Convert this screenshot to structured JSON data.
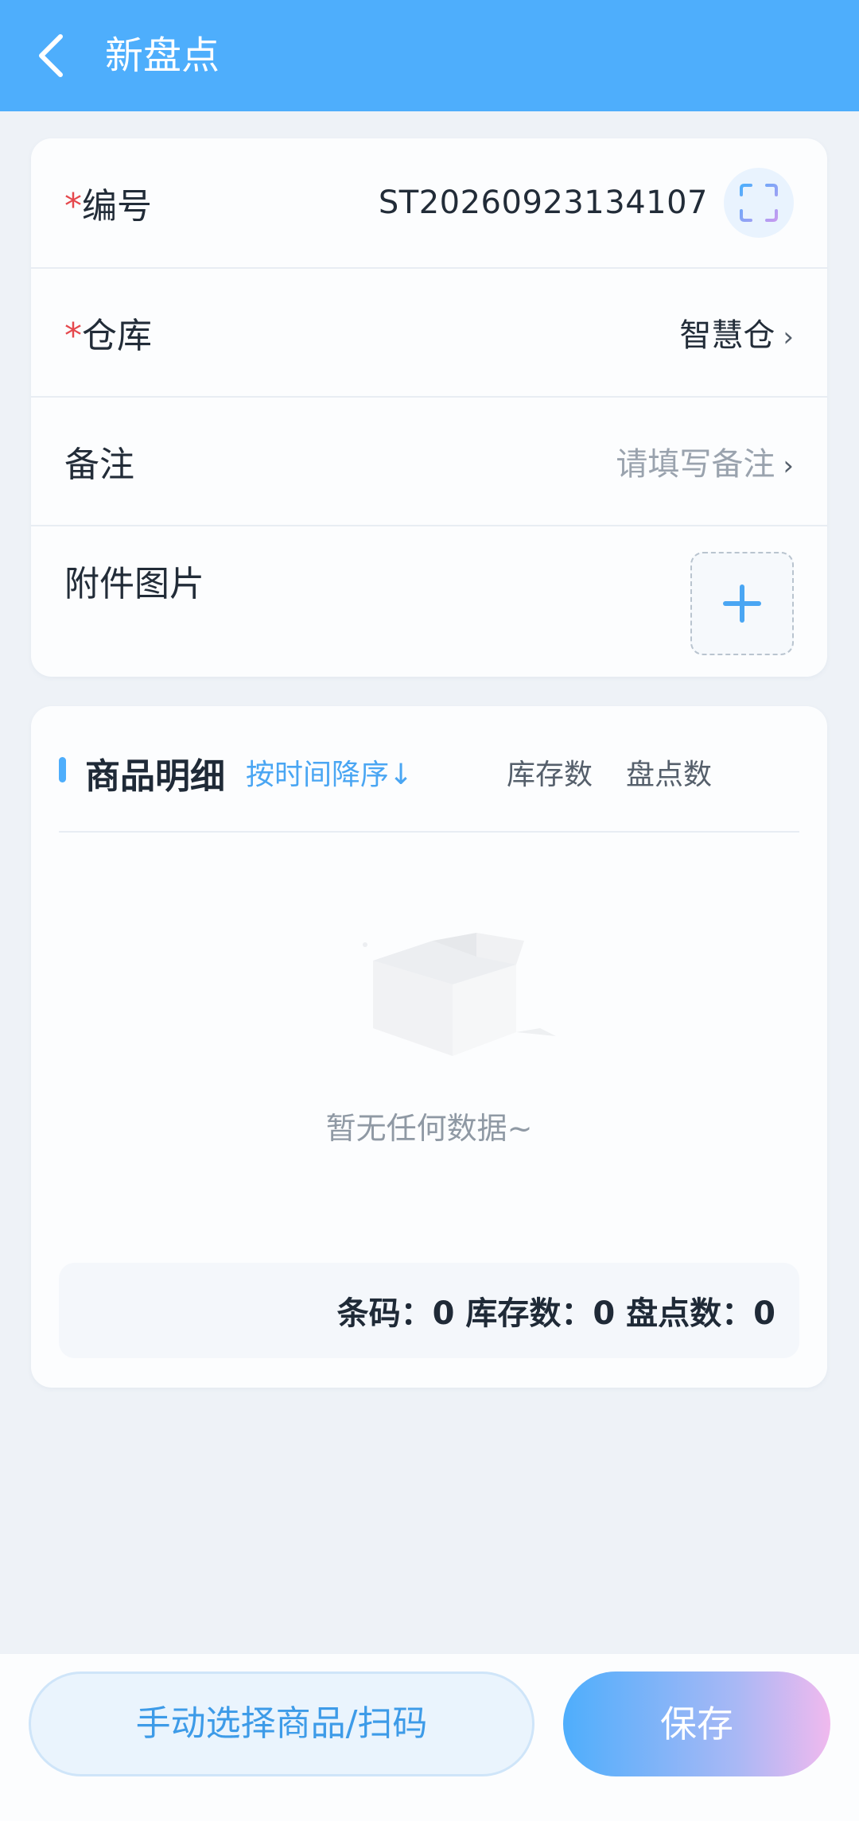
{
  "header": {
    "title": "新盘点",
    "back_icon": "chevron-left-icon"
  },
  "form": {
    "code": {
      "required_mark": "*",
      "label": "编号",
      "value": "ST20260923134107",
      "scan_icon": "scan-icon"
    },
    "warehouse": {
      "required_mark": "*",
      "label": "仓库",
      "value": "智慧仓",
      "chevron": "›"
    },
    "remark": {
      "label": "备注",
      "placeholder": "请填写备注",
      "chevron": "›"
    },
    "attachment": {
      "label": "附件图片",
      "add_icon": "plus-icon"
    }
  },
  "list": {
    "title": "商品明细",
    "sort_label": "按时间降序",
    "sort_icon": "↓",
    "columns": {
      "stock": "库存数",
      "count": "盘点数"
    },
    "empty_text": "暂无任何数据~",
    "summary": "条码：0 库存数：0 盘点数：0"
  },
  "actions": {
    "manual_label": "手动选择商品/扫码",
    "save_label": "保存"
  },
  "colors": {
    "primary": "#4eaefc",
    "required": "#e5484d",
    "background": "#eef2f7"
  }
}
